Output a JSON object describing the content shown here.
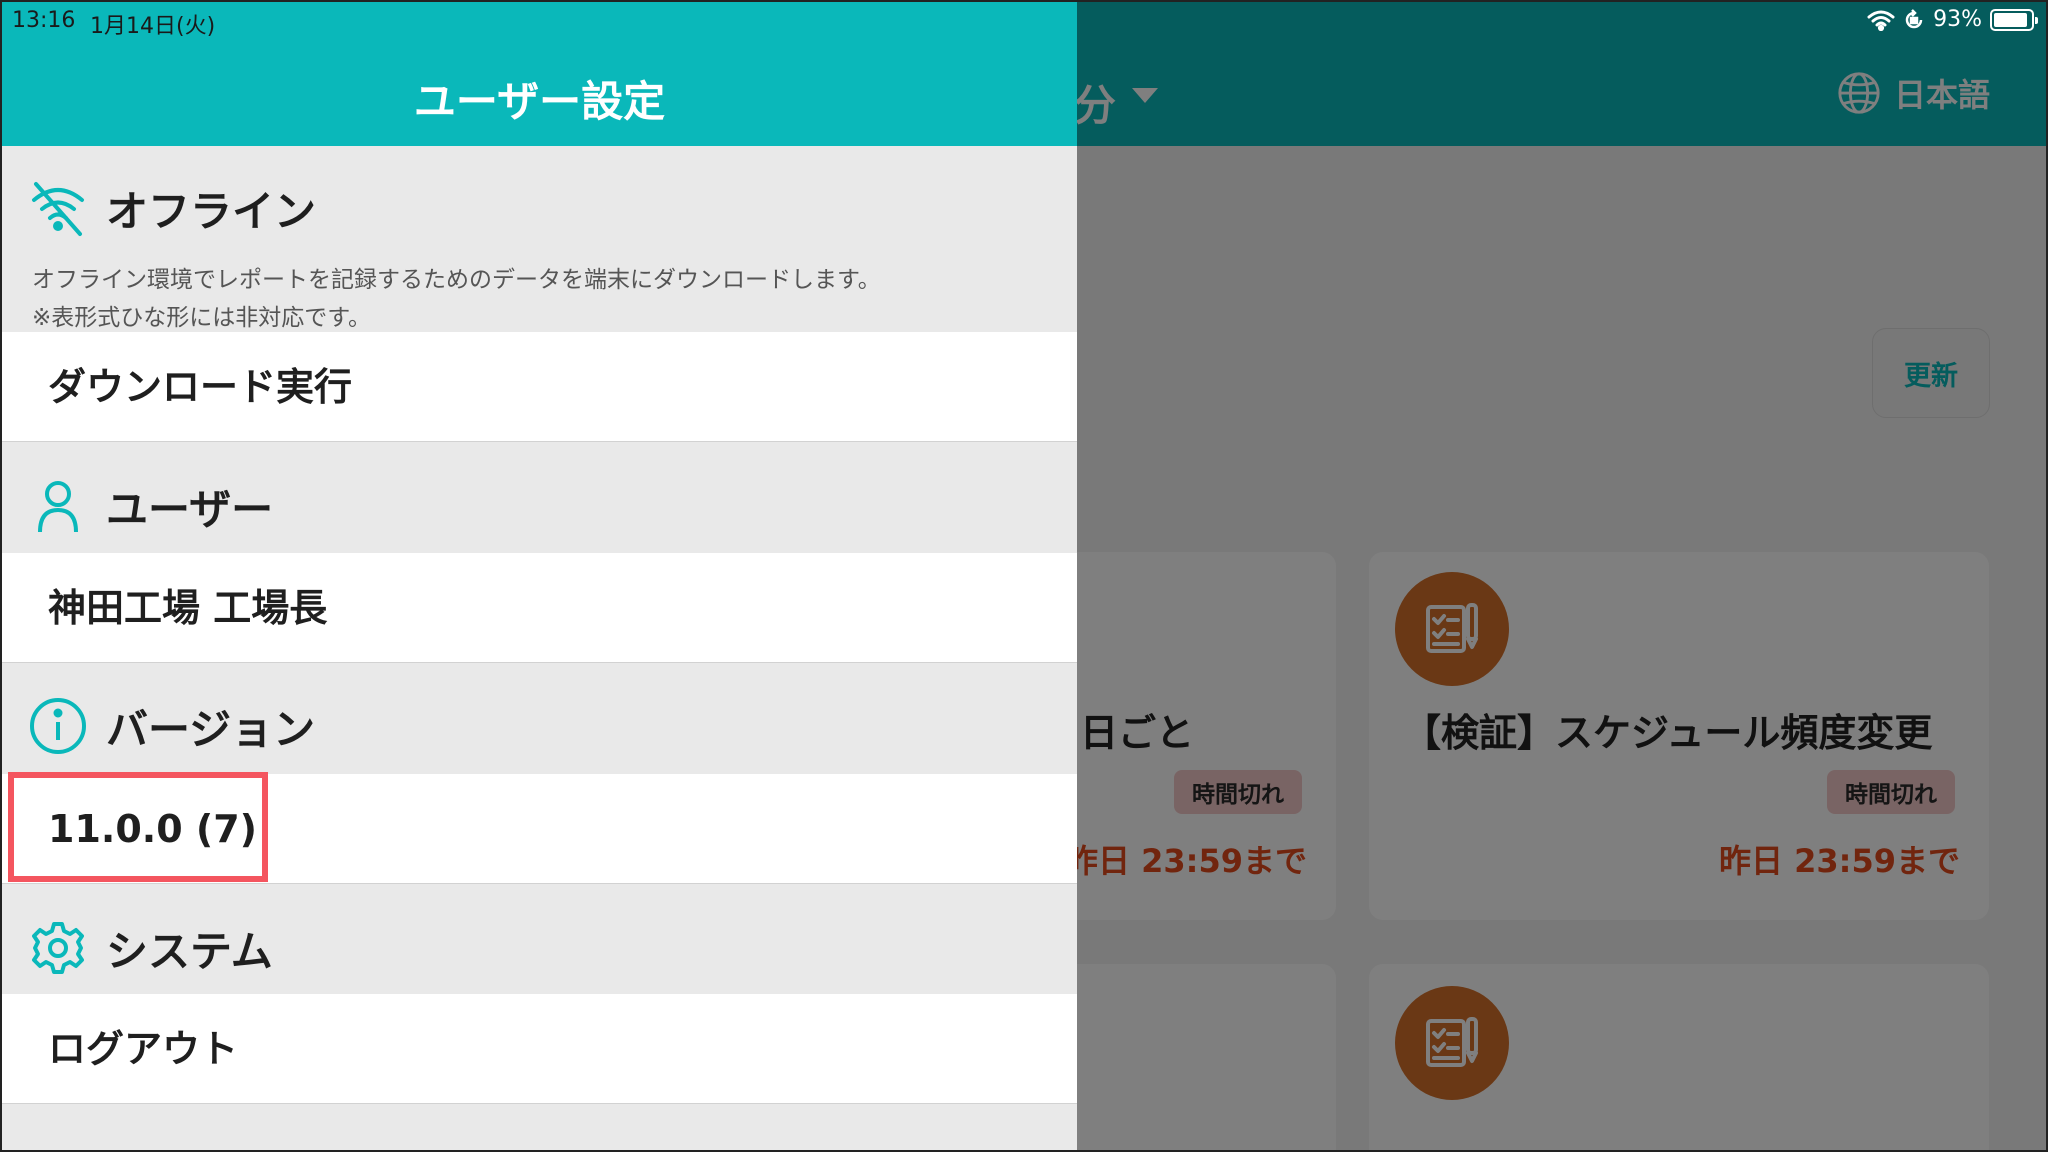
{
  "status_bar": {
    "time": "13:16",
    "date": "1月14日(火)",
    "battery": "93%",
    "battery_level": 0.93
  },
  "background_app": {
    "header_partial_title": "分",
    "language_label": "日本語",
    "refresh_label": "更新",
    "cards": [
      {
        "title_partial": "日ごと",
        "badge": "時間切れ",
        "deadline": "昨日 23:59まで"
      },
      {
        "title": "【検証】スケジュール頻度変更",
        "badge": "時間切れ",
        "deadline": "昨日 23:59まで"
      }
    ]
  },
  "drawer": {
    "title": "ユーザー設定",
    "sections": {
      "offline": {
        "label": "オフライン",
        "description_line1": "オフライン環境でレポートを記録するためのデータを端末にダウンロードします。",
        "description_line2": "※表形式ひな形には非対応です。",
        "action_label": "ダウンロード実行"
      },
      "user": {
        "label": "ユーザー",
        "value": "神田工場 工場長"
      },
      "version": {
        "label": "バージョン",
        "value": "11.0.0 (7)"
      },
      "system": {
        "label": "システム",
        "action_label": "ログアウト"
      }
    }
  },
  "colors": {
    "accent": "#0ab8ba",
    "card_icon": "#d4702a",
    "deadline": "#e24b1d",
    "badge_bg": "#f3c9c9",
    "highlight": "#f4555f"
  },
  "icons": {
    "offline": "wifi-off-icon",
    "user": "user-icon",
    "version": "info-icon",
    "system": "gear-icon",
    "language": "globe-icon",
    "card": "report-checklist-icon"
  }
}
